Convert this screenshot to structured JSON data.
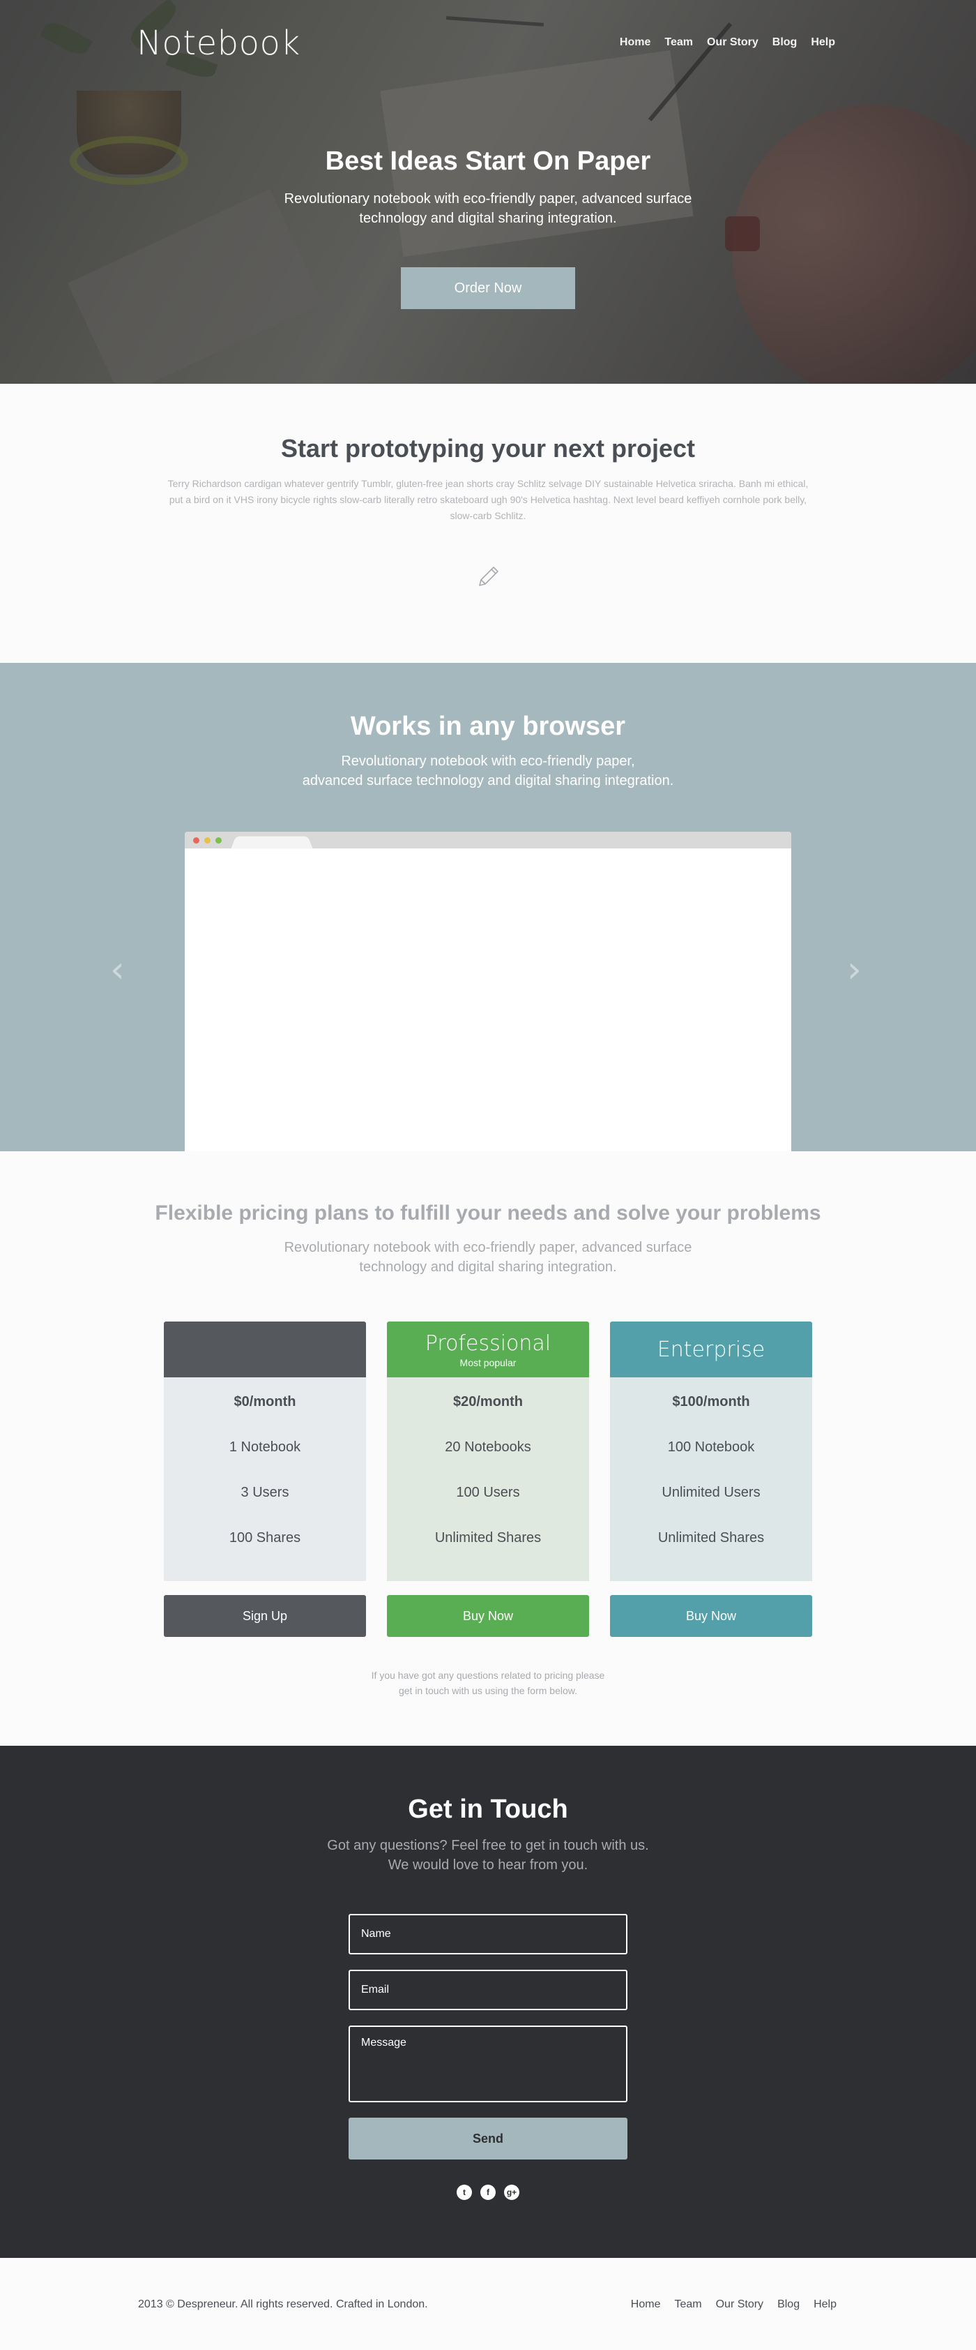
{
  "header": {
    "logo": "Notebook",
    "nav": [
      "Home",
      "Team",
      "Our Story",
      "Blog",
      "Help"
    ]
  },
  "hero": {
    "title": "Best Ideas Start On Paper",
    "subtitle": "Revolutionary notebook with eco-friendly paper, advanced surface technology and digital sharing integration.",
    "cta": "Order Now"
  },
  "prototype": {
    "title": "Start prototyping your next project",
    "text": "Terry Richardson cardigan whatever gentrify Tumblr, gluten-free jean shorts cray Schlitz selvage DIY sustainable Helvetica sriracha. Banh mi ethical, put a bird on it VHS irony bicycle rights slow-carb literally retro skateboard ugh 90's Helvetica hashtag. Next level beard keffiyeh cornhole pork belly, slow-carb Schlitz.",
    "icon": "pencil-icon"
  },
  "browser_section": {
    "title": "Works in any browser",
    "subtitle_line1": "Revolutionary notebook with eco-friendly paper,",
    "subtitle_line2": "advanced surface technology and digital sharing integration.",
    "prev": "‹",
    "next": "›"
  },
  "pricing": {
    "title": "Flexible pricing plans to fulfill your needs and solve your problems",
    "subtitle": "Revolutionary notebook with eco-friendly paper, advanced surface technology and digital sharing integration.",
    "plans": [
      {
        "name": "",
        "note": "",
        "price": "$0/month",
        "f1": "1 Notebook",
        "f2": "3 Users",
        "f3": "100 Shares",
        "button": "Sign Up",
        "color": "#55595e",
        "body_color": "#e8ebee"
      },
      {
        "name": "Professional",
        "note": "Most popular",
        "price": "$20/month",
        "f1": "20 Notebooks",
        "f2": "100 Users",
        "f3": "Unlimited Shares",
        "button": "Buy Now",
        "color": "#59ad53",
        "body_color": "#dfe9df"
      },
      {
        "name": "Enterprise",
        "note": "",
        "price": "$100/month",
        "f1": "100 Notebook",
        "f2": "Unlimited Users",
        "f3": "Unlimited Shares",
        "button": "Buy Now",
        "color": "#53a0ab",
        "body_color": "#dde7e8"
      }
    ],
    "note_line1": "If you have got any questions related to pricing please",
    "note_line2": "get in touch with us using the form below."
  },
  "contact": {
    "title": "Get in Touch",
    "subtitle_line1": "Got any questions? Feel free to get in touch with us.",
    "subtitle_line2": "We would love to hear from you.",
    "name_placeholder": "Name",
    "email_placeholder": "Email",
    "message_placeholder": "Message",
    "send": "Send",
    "social": [
      "twitter-icon",
      "facebook-icon",
      "google-plus-icon"
    ]
  },
  "footer": {
    "copyright": "2013 ©  Despreneur. All rights reserved. Crafted in London.",
    "nav": [
      "Home",
      "Team",
      "Our Story",
      "Blog",
      "Help"
    ]
  }
}
